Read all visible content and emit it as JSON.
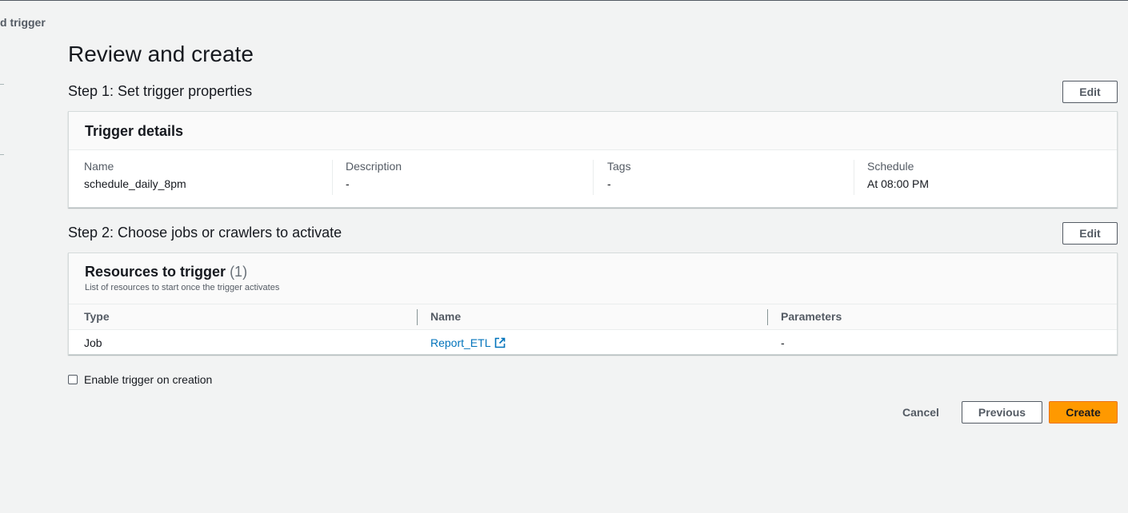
{
  "sidebar": {
    "crumb": "d trigger"
  },
  "page": {
    "title": "Review and create"
  },
  "step1": {
    "heading": "Step 1: Set trigger properties",
    "edit_label": "Edit",
    "panel": {
      "title": "Trigger details",
      "fields": [
        {
          "label": "Name",
          "value": "schedule_daily_8pm"
        },
        {
          "label": "Description",
          "value": "-"
        },
        {
          "label": "Tags",
          "value": "-"
        },
        {
          "label": "Schedule",
          "value": "At 08:00 PM"
        }
      ]
    }
  },
  "step2": {
    "heading": "Step 2: Choose jobs or crawlers to activate",
    "edit_label": "Edit",
    "panel": {
      "title": "Resources to trigger",
      "count": "(1)",
      "description": "List of resources to start once the trigger activates",
      "columns": [
        "Type",
        "Name",
        "Parameters"
      ],
      "rows": [
        {
          "type": "Job",
          "name": "Report_ETL",
          "parameters": "-"
        }
      ]
    }
  },
  "options": {
    "enable_trigger_label": "Enable trigger on creation",
    "enable_trigger_checked": false
  },
  "actions": {
    "cancel_label": "Cancel",
    "previous_label": "Previous",
    "create_label": "Create"
  },
  "icons": {
    "external_link": "external-link-icon"
  },
  "colors": {
    "primary": "#ff9900",
    "link": "#0073bb",
    "background": "#f2f3f3"
  }
}
